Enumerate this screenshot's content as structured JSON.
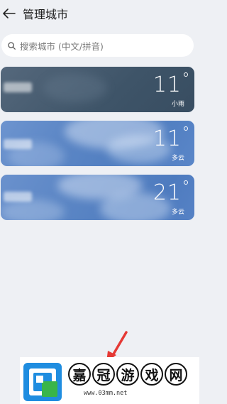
{
  "header": {
    "title": "管理城市"
  },
  "search": {
    "placeholder": "搜索城市 (中文/拼音)"
  },
  "cities": [
    {
      "temp": "11",
      "condition": "小雨"
    },
    {
      "temp": "11",
      "condition": "多云"
    },
    {
      "temp": "21",
      "condition": "多云"
    }
  ],
  "watermark": {
    "chars": [
      "嘉",
      "冠",
      "游",
      "戏",
      "网"
    ],
    "url": "www.03mm.net"
  },
  "colors": {
    "accent": "#e53935",
    "card_rain": "#3e5468",
    "card_cloudy": "#5b86c5"
  }
}
